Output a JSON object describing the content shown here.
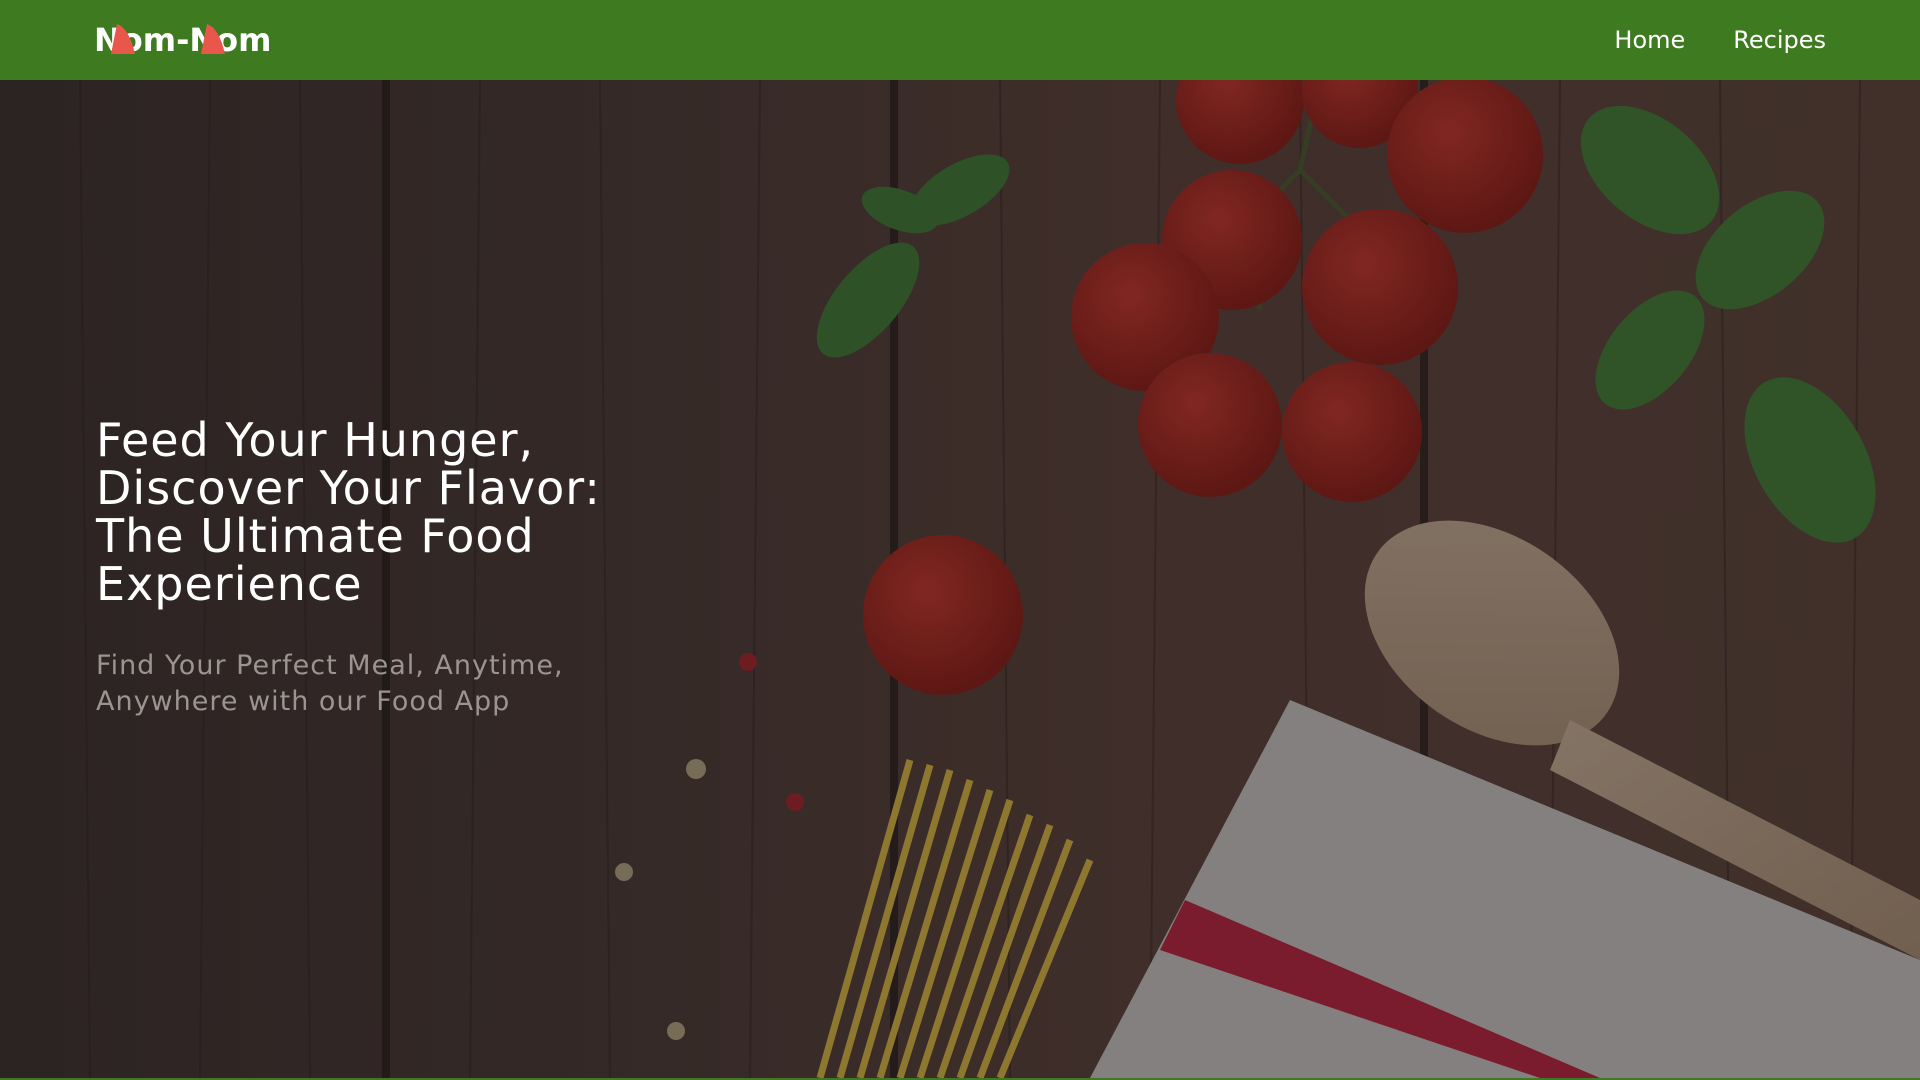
{
  "navbar": {
    "logo_text": "Nom-Nom",
    "links": [
      {
        "label": "Home"
      },
      {
        "label": "Recipes"
      }
    ],
    "background_color": "#3e7a20",
    "logo_accent_color": "#e8574a"
  },
  "hero": {
    "title": "Feed Your Hunger, Discover Your Flavor: The Ultimate Food Experience",
    "subtitle": "Find Your Perfect Meal, Anytime, Anywhere with our Food App",
    "background_image": "wooden-table-with-cherry-tomatoes-basil-wooden-spoon-spaghetti-towel"
  }
}
